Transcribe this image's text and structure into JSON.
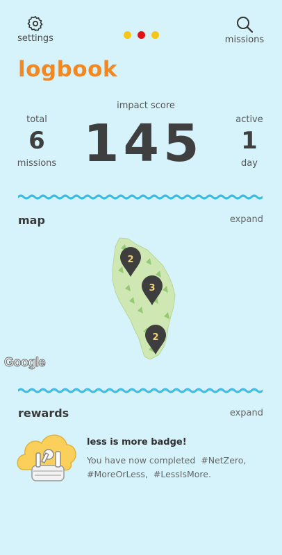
{
  "header": {
    "settings_label": "settings",
    "missions_label": "missions",
    "page_dots": [
      {
        "color": "#f5c518",
        "active": false
      },
      {
        "color": "#e0131a",
        "active": true
      },
      {
        "color": "#f5c518",
        "active": false
      }
    ]
  },
  "title": "logbook",
  "accent_color": "#f5871f",
  "stats": {
    "impact_label": "impact score",
    "impact_value": "145",
    "total_top": "total",
    "total_value": "6",
    "total_bottom": "missions",
    "active_top": "active",
    "active_value": "1",
    "active_bottom": "day"
  },
  "map_section": {
    "heading": "map",
    "expand_label": "expand",
    "pins": [
      {
        "count": "2"
      },
      {
        "count": "3"
      },
      {
        "count": "2"
      }
    ],
    "attribution": "Google"
  },
  "rewards_section": {
    "heading": "rewards",
    "expand_label": "expand",
    "badge_title": "less is more badge!",
    "badge_desc": [
      "You have now completed",
      "#NetZero,",
      "#MoreOrLess,",
      "#LessIsMore."
    ]
  },
  "wave_color": "#3bbbe6"
}
